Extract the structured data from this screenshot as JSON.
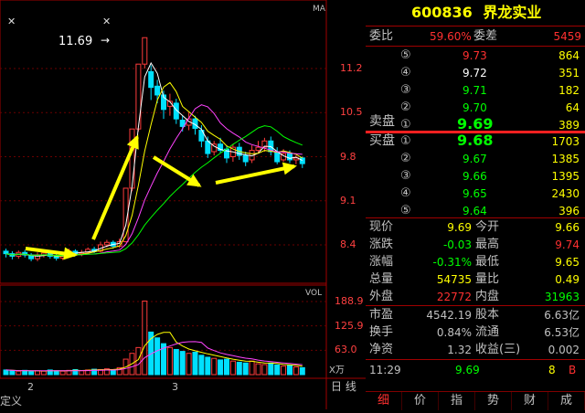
{
  "chart": {
    "label_ma": "MA",
    "label_vol": "VOL",
    "peak_price": "11.69",
    "price_axis": [
      "11.2",
      "10.5",
      "9.8",
      "9.1",
      "8.4"
    ],
    "vol_axis": [
      "188.9",
      "125.9",
      "63.0"
    ],
    "vol_unit": "X万",
    "x_labels": [
      "2",
      "3"
    ],
    "bottom_left": "定义",
    "bottom_right": "日 线",
    "colors": {
      "up": "#ff3b3b",
      "down": "#00e0ff",
      "ma_white": "#ffffff",
      "ma_yellow": "#ffff00",
      "ma_magenta": "#ff44ff",
      "ma_green": "#00ff00",
      "arrow": "#ffff00"
    },
    "candles": [
      {
        "o": 8.3,
        "c": 8.26,
        "h": 8.34,
        "l": 8.2
      },
      {
        "o": 8.26,
        "c": 8.22,
        "h": 8.3,
        "l": 8.17
      },
      {
        "o": 8.22,
        "c": 8.28,
        "h": 8.31,
        "l": 8.18
      },
      {
        "o": 8.28,
        "c": 8.24,
        "h": 8.32,
        "l": 8.2
      },
      {
        "o": 8.24,
        "c": 8.18,
        "h": 8.27,
        "l": 8.14
      },
      {
        "o": 8.18,
        "c": 8.24,
        "h": 8.28,
        "l": 8.14
      },
      {
        "o": 8.24,
        "c": 8.27,
        "h": 8.31,
        "l": 8.2
      },
      {
        "o": 8.27,
        "c": 8.22,
        "h": 8.3,
        "l": 8.18
      },
      {
        "o": 8.22,
        "c": 8.19,
        "h": 8.26,
        "l": 8.15
      },
      {
        "o": 8.19,
        "c": 8.25,
        "h": 8.29,
        "l": 8.16
      },
      {
        "o": 8.25,
        "c": 8.3,
        "h": 8.34,
        "l": 8.22
      },
      {
        "o": 8.3,
        "c": 8.26,
        "h": 8.33,
        "l": 8.22
      },
      {
        "o": 8.26,
        "c": 8.28,
        "h": 8.32,
        "l": 8.22
      },
      {
        "o": 8.28,
        "c": 8.33,
        "h": 8.36,
        "l": 8.25
      },
      {
        "o": 8.33,
        "c": 8.3,
        "h": 8.37,
        "l": 8.27
      },
      {
        "o": 8.3,
        "c": 8.4,
        "h": 8.45,
        "l": 8.28
      },
      {
        "o": 8.4,
        "c": 8.44,
        "h": 8.48,
        "l": 8.36
      },
      {
        "o": 8.44,
        "c": 8.38,
        "h": 8.47,
        "l": 8.34
      },
      {
        "o": 8.38,
        "c": 8.45,
        "h": 8.5,
        "l": 8.35
      },
      {
        "o": 8.45,
        "c": 9.3,
        "h": 9.3,
        "l": 8.44
      },
      {
        "o": 9.3,
        "c": 10.24,
        "h": 10.24,
        "l": 9.25
      },
      {
        "o": 10.24,
        "c": 11.27,
        "h": 11.27,
        "l": 10.2
      },
      {
        "o": 11.27,
        "c": 11.69,
        "h": 11.69,
        "l": 11.2
      },
      {
        "o": 11.15,
        "c": 10.9,
        "h": 11.25,
        "l": 10.7
      },
      {
        "o": 10.92,
        "c": 10.78,
        "h": 11.02,
        "l": 10.65
      },
      {
        "o": 10.78,
        "c": 10.55,
        "h": 10.85,
        "l": 10.4
      },
      {
        "o": 10.6,
        "c": 10.68,
        "h": 10.8,
        "l": 10.45
      },
      {
        "o": 10.65,
        "c": 10.4,
        "h": 10.72,
        "l": 10.32
      },
      {
        "o": 10.38,
        "c": 10.28,
        "h": 10.45,
        "l": 10.2
      },
      {
        "o": 10.3,
        "c": 10.4,
        "h": 10.5,
        "l": 10.22
      },
      {
        "o": 10.4,
        "c": 10.25,
        "h": 10.45,
        "l": 10.15
      },
      {
        "o": 10.22,
        "c": 10.05,
        "h": 10.3,
        "l": 9.95
      },
      {
        "o": 10.05,
        "c": 9.85,
        "h": 10.12,
        "l": 9.78
      },
      {
        "o": 9.88,
        "c": 10.0,
        "h": 10.05,
        "l": 9.82
      },
      {
        "o": 10.0,
        "c": 9.9,
        "h": 10.1,
        "l": 9.85
      },
      {
        "o": 9.92,
        "c": 9.78,
        "h": 9.98,
        "l": 9.7
      },
      {
        "o": 9.8,
        "c": 9.95,
        "h": 10.0,
        "l": 9.72
      },
      {
        "o": 9.95,
        "c": 9.82,
        "h": 10.02,
        "l": 9.75
      },
      {
        "o": 9.82,
        "c": 9.72,
        "h": 9.88,
        "l": 9.65
      },
      {
        "o": 9.75,
        "c": 9.9,
        "h": 9.98,
        "l": 9.7
      },
      {
        "o": 9.9,
        "c": 9.95,
        "h": 10.05,
        "l": 9.85
      },
      {
        "o": 9.95,
        "c": 10.05,
        "h": 10.1,
        "l": 9.88
      },
      {
        "o": 10.05,
        "c": 9.88,
        "h": 10.12,
        "l": 9.82
      },
      {
        "o": 9.88,
        "c": 9.72,
        "h": 9.95,
        "l": 9.68
      },
      {
        "o": 9.75,
        "c": 9.85,
        "h": 9.92,
        "l": 9.72
      },
      {
        "o": 9.85,
        "c": 9.75,
        "h": 9.9,
        "l": 9.7
      },
      {
        "o": 9.75,
        "c": 9.78,
        "h": 9.82,
        "l": 9.68
      },
      {
        "o": 9.78,
        "c": 9.69,
        "h": 9.8,
        "l": 9.62
      }
    ],
    "volumes": [
      12,
      10,
      9,
      11,
      8,
      10,
      9,
      12,
      10,
      9,
      11,
      13,
      10,
      12,
      14,
      13,
      15,
      12,
      18,
      40,
      55,
      70,
      190,
      110,
      95,
      80,
      70,
      65,
      60,
      55,
      58,
      50,
      45,
      42,
      38,
      40,
      35,
      32,
      30,
      35,
      28,
      26,
      30,
      25,
      22,
      24,
      20,
      18
    ]
  },
  "header": {
    "code": "600836",
    "name": "界龙实业"
  },
  "webi": {
    "label": "委比",
    "value": "59.60%",
    "diff_label": "委差",
    "diff_value": "5459"
  },
  "asks": [
    {
      "label": "卖盘",
      "level": "⑤",
      "price": "9.73",
      "vol": "864"
    },
    {
      "label": "",
      "level": "④",
      "price": "9.72",
      "vol": "351"
    },
    {
      "label": "",
      "level": "③",
      "price": "9.71",
      "vol": "182"
    },
    {
      "label": "",
      "level": "②",
      "price": "9.70",
      "vol": "64"
    },
    {
      "label": "",
      "level": "①",
      "price": "9.69",
      "vol": "389"
    }
  ],
  "ask_title": "卖盘",
  "bid_title": "买盘",
  "bids": [
    {
      "level": "①",
      "price": "9.68",
      "vol": "1703"
    },
    {
      "level": "②",
      "price": "9.67",
      "vol": "1385"
    },
    {
      "level": "③",
      "price": "9.66",
      "vol": "1395"
    },
    {
      "level": "④",
      "price": "9.65",
      "vol": "2430"
    },
    {
      "level": "⑤",
      "price": "9.64",
      "vol": "396"
    }
  ],
  "stats": [
    {
      "l1": "现价",
      "v1": "9.69",
      "c1": "#ffff00",
      "l2": "今开",
      "v2": "9.66",
      "c2": "#ffff00"
    },
    {
      "l1": "涨跌",
      "v1": "-0.03",
      "c1": "#00ff00",
      "l2": "最高",
      "v2": "9.74",
      "c2": "#ff3030"
    },
    {
      "l1": "涨幅",
      "v1": "-0.31%",
      "c1": "#00ff00",
      "l2": "最低",
      "v2": "9.65",
      "c2": "#ffff00"
    },
    {
      "l1": "总量",
      "v1": "54735",
      "c1": "#ffff00",
      "l2": "量比",
      "v2": "0.49",
      "c2": "#ffff00"
    },
    {
      "l1": "外盘",
      "v1": "22772",
      "c1": "#ff3030",
      "l2": "内盘",
      "v2": "31963",
      "c2": "#00ff00"
    }
  ],
  "fundamentals": [
    {
      "l1": "市盈",
      "v1": "4542.19",
      "l2": "股本",
      "v2": "6.63亿"
    },
    {
      "l1": "换手",
      "v1": "0.84%",
      "l2": "流通",
      "v2": "6.53亿"
    },
    {
      "l1": "净资",
      "v1": "1.32",
      "l2": "收益(三)",
      "v2": "0.002"
    }
  ],
  "tick": {
    "time": "11:29",
    "price": "9.69",
    "vol": "8",
    "flag": "B"
  },
  "tabs": [
    "细",
    "价",
    "指",
    "势",
    "财",
    "成"
  ]
}
